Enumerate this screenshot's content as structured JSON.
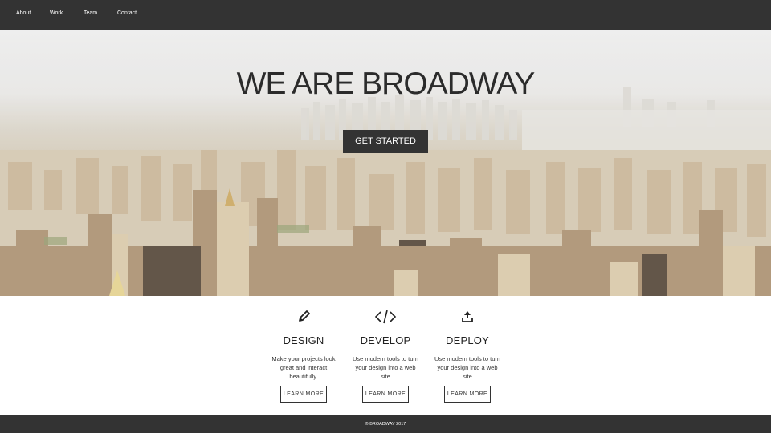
{
  "nav": {
    "items": [
      {
        "label": "About"
      },
      {
        "label": "Work"
      },
      {
        "label": "Team"
      },
      {
        "label": "Contact"
      }
    ]
  },
  "hero": {
    "title": "WE ARE BROADWAY",
    "cta_label": "GET STARTED",
    "image": "city-skyline-photo"
  },
  "features": [
    {
      "icon": "pencil-icon",
      "title": "DESIGN",
      "description": "Make your projects look great and interact beautifully.",
      "button": "LEARN MORE"
    },
    {
      "icon": "code-icon",
      "title": "DEVELOP",
      "description": "Use modern tools to turn your design into a web site",
      "button": "LEARN MORE"
    },
    {
      "icon": "upload-icon",
      "title": "DEPLOY",
      "description": "Use modern tools to turn your design into a web site",
      "button": "LEARN MORE"
    }
  ],
  "footer": {
    "copyright": "© BROADWAY 2017"
  },
  "colors": {
    "dark": "#333333",
    "light_text": "#ffffff",
    "heading": "#2b2b2b"
  }
}
